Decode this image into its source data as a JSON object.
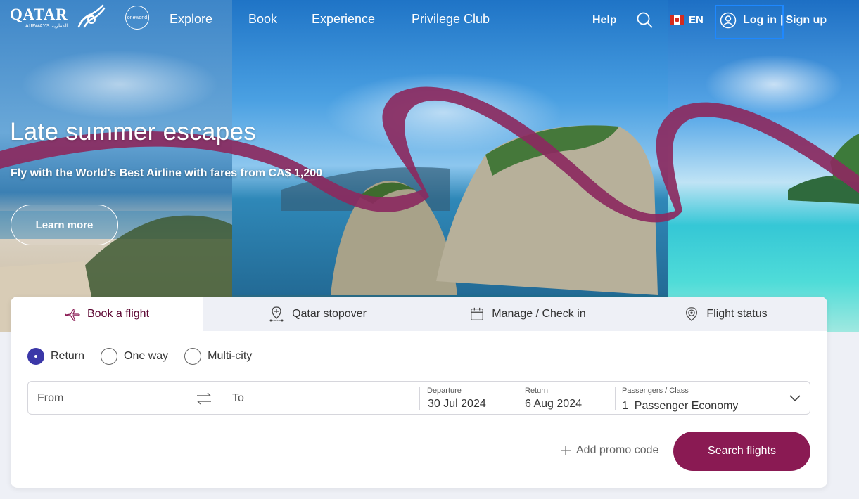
{
  "brand": {
    "logo_word": "QATAR",
    "logo_sub": "AIRWAYS القطرية",
    "alliance": "oneworld"
  },
  "nav": {
    "links": [
      "Explore",
      "Book",
      "Experience",
      "Privilege Club"
    ],
    "help": "Help",
    "language": "EN",
    "login": "Log in",
    "separator": "|",
    "signup": "Sign up"
  },
  "hero": {
    "title": "Late summer escapes",
    "subtitle": "Fly with the World's Best Airline with fares from CA$ 1,200",
    "cta": "Learn more"
  },
  "booking": {
    "tabs": [
      {
        "label": "Book a flight",
        "icon": "plane-icon",
        "active": true
      },
      {
        "label": "Qatar stopover",
        "icon": "stopover-pin-icon",
        "active": false
      },
      {
        "label": "Manage / Check in",
        "icon": "calendar-icon",
        "active": false
      },
      {
        "label": "Flight status",
        "icon": "location-pin-icon",
        "active": false
      }
    ],
    "trip_types": [
      {
        "label": "Return",
        "checked": true
      },
      {
        "label": "One way",
        "checked": false
      },
      {
        "label": "Multi-city",
        "checked": false
      }
    ],
    "from_placeholder": "From",
    "to_placeholder": "To",
    "departure_label": "Departure",
    "departure_value": "30 Jul 2024",
    "return_label": "Return",
    "return_value": "6 Aug 2024",
    "passengers_label": "Passengers / Class",
    "passengers_value": "1  Passenger Economy",
    "promo": "Add promo code",
    "search_button": "Search flights"
  },
  "colors": {
    "brand_maroon": "#8a1a53",
    "radio_checked": "#3b37a8",
    "focus_outline": "#1e88ff"
  }
}
